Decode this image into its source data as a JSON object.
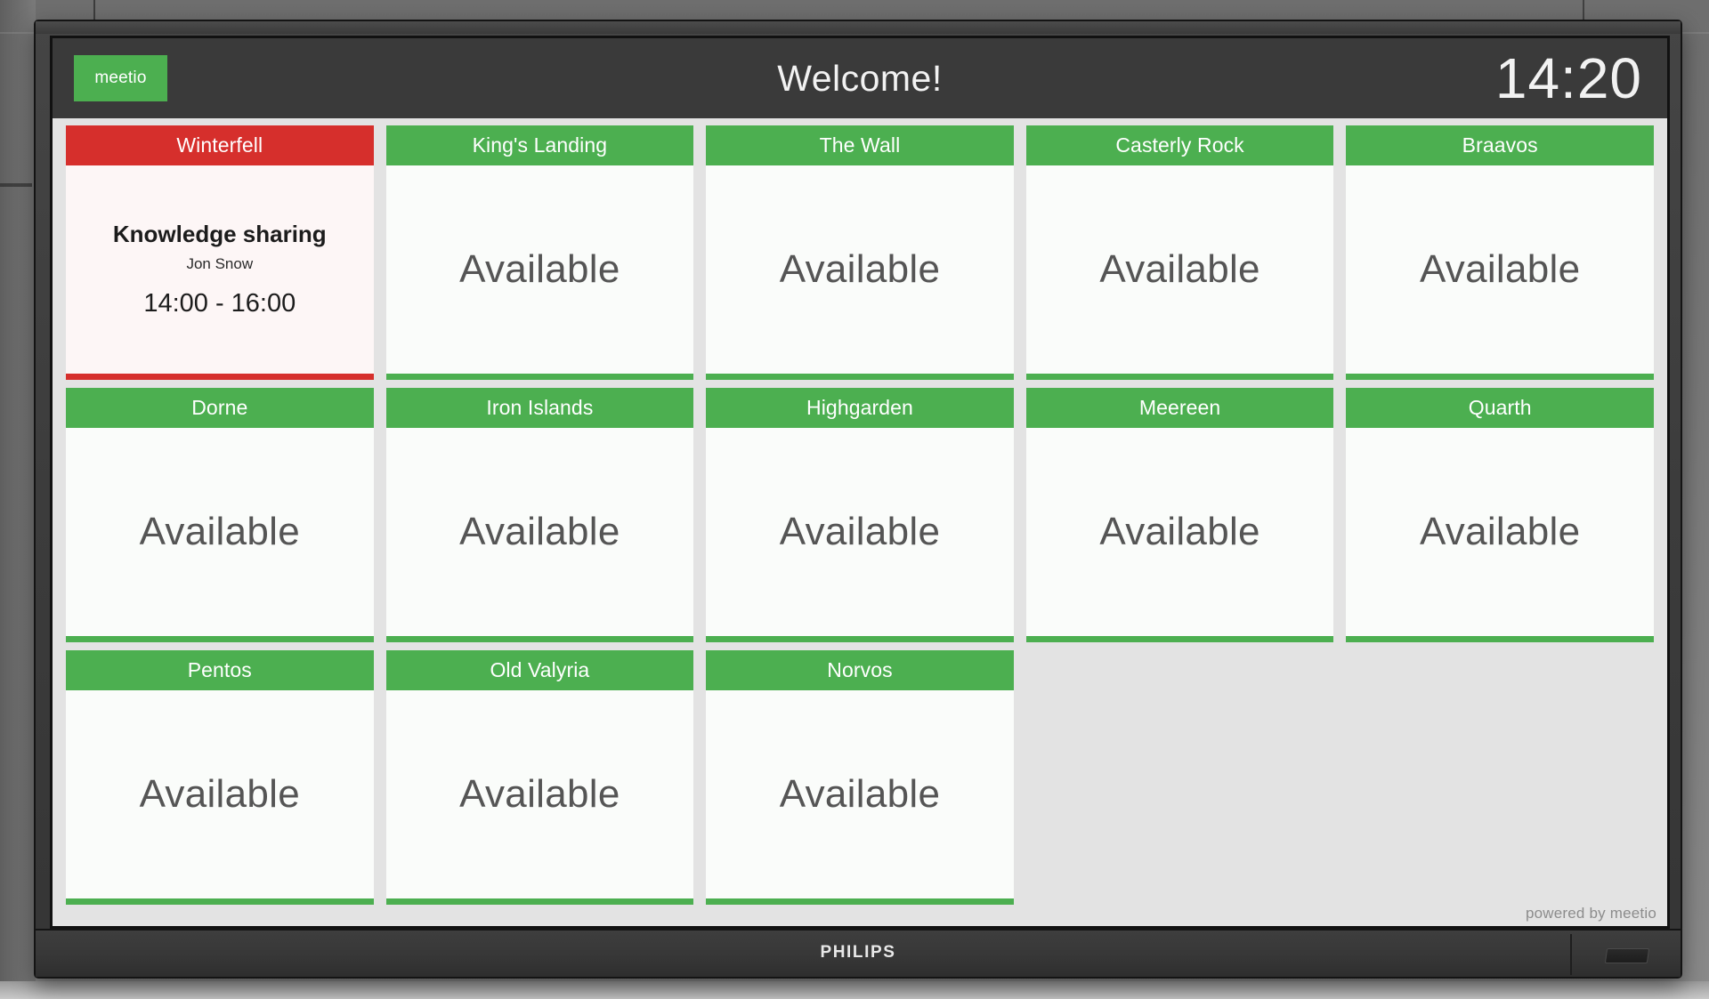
{
  "device": {
    "manufacturer_logo": "PHILIPS"
  },
  "app": {
    "brand_logo": "meetio",
    "title": "Welcome!",
    "clock": "14:20",
    "footer_credit": "powered by meetio",
    "colors": {
      "available": "#4caf50",
      "busy": "#d62f2c",
      "header_bar": "#3a3a3a",
      "screen_bg": "#e3e3e3"
    },
    "status_labels": {
      "available": "Available"
    }
  },
  "rooms": [
    {
      "name": "Winterfell",
      "status": "busy",
      "meeting": {
        "title": "Knowledge sharing",
        "organizer": "Jon Snow",
        "time": "14:00 - 16:00"
      }
    },
    {
      "name": "King's Landing",
      "status": "free",
      "status_text": "Available"
    },
    {
      "name": "The Wall",
      "status": "free",
      "status_text": "Available"
    },
    {
      "name": "Casterly Rock",
      "status": "free",
      "status_text": "Available"
    },
    {
      "name": "Braavos",
      "status": "free",
      "status_text": "Available"
    },
    {
      "name": "Dorne",
      "status": "free",
      "status_text": "Available"
    },
    {
      "name": "Iron Islands",
      "status": "free",
      "status_text": "Available"
    },
    {
      "name": "Highgarden",
      "status": "free",
      "status_text": "Available"
    },
    {
      "name": "Meereen",
      "status": "free",
      "status_text": "Available"
    },
    {
      "name": "Quarth",
      "status": "free",
      "status_text": "Available"
    },
    {
      "name": "Pentos",
      "status": "free",
      "status_text": "Available"
    },
    {
      "name": "Old Valyria",
      "status": "free",
      "status_text": "Available"
    },
    {
      "name": "Norvos",
      "status": "free",
      "status_text": "Available"
    }
  ]
}
